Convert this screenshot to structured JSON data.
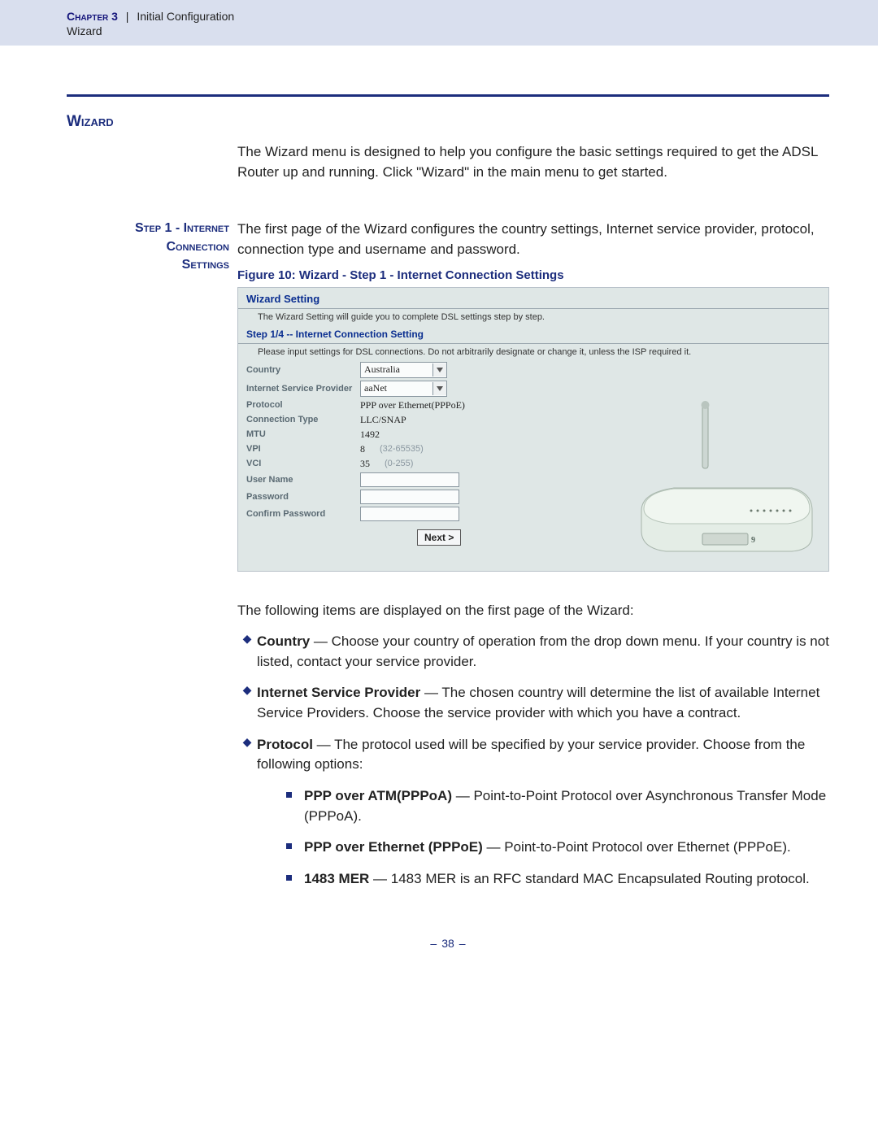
{
  "header": {
    "chapter_label": "Chapter 3",
    "separator": "|",
    "section": "Initial Configuration",
    "sub": "Wizard"
  },
  "title": "Wizard",
  "intro": "The Wizard menu is designed to help you configure the basic settings required to get the ADSL Router up and running. Click \"Wizard\" in the main menu to get started.",
  "step": {
    "side_line1": "Step 1 - Internet",
    "side_line2": "Connection",
    "side_line3": "Settings",
    "lead": "The first page of the Wizard configures the country settings, Internet service provider, protocol, connection type and username and password.",
    "caption": "Figure 10:  Wizard - Step 1 - Internet Connection Settings"
  },
  "shot": {
    "panel_title": "Wizard Setting",
    "panel_desc": "The Wizard Setting will guide you to complete DSL settings step by step.",
    "step_title": "Step 1/4 -- Internet Connection Setting",
    "step_desc": "Please input settings for DSL connections. Do not arbitrarily designate or change it, unless the ISP required it.",
    "labels": {
      "country": "Country",
      "isp": "Internet Service Provider",
      "protocol": "Protocol",
      "conn_type": "Connection Type",
      "mtu": "MTU",
      "vpi": "VPI",
      "vci": "VCI",
      "user": "User Name",
      "pass": "Password",
      "confirm": "Confirm Password"
    },
    "values": {
      "country": "Australia",
      "isp": "aaNet",
      "protocol": "PPP over Ethernet(PPPoE)",
      "conn_type": "LLC/SNAP",
      "mtu": "1492",
      "vpi": "8",
      "vpi_hint": "(32-65535)",
      "vci": "35",
      "vci_hint": "(0-255)"
    },
    "next": "Next >"
  },
  "post": "The following items are displayed on the first page of the Wizard:",
  "items": {
    "country": {
      "t": "Country",
      "d": " — Choose your country of operation from the drop down menu. If your country is not listed, contact your service provider."
    },
    "isp": {
      "t": "Internet Service Provider",
      "d": " — The chosen country will determine the list of available Internet Service Providers. Choose the service provider with which you have a contract."
    },
    "protocol": {
      "t": "Protocol",
      "d": " — The protocol used will be specified by your service provider. Choose from the following options:"
    }
  },
  "protocols": {
    "pppoa": {
      "t": "PPP over ATM(PPPoA)",
      "d": " — Point-to-Point Protocol over Asynchronous Transfer Mode (PPPoA)."
    },
    "pppoe": {
      "t": "PPP over Ethernet (PPPoE)",
      "d": " — Point-to-Point Protocol over Ethernet (PPPoE)."
    },
    "mer": {
      "t": "1483 MER",
      "d": " — 1483 MER is an RFC standard MAC Encapsulated Routing protocol."
    }
  },
  "pagenum": "38"
}
